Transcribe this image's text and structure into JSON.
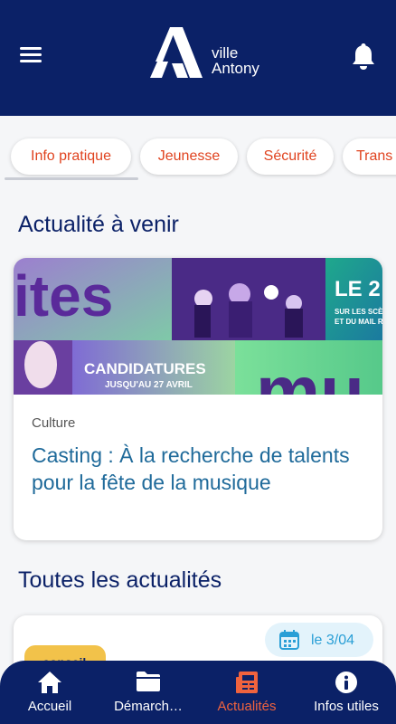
{
  "header": {
    "logo_line1": "ville",
    "logo_line2": "Antony",
    "menu_icon": "hamburger-menu-icon",
    "notification_icon": "bell-icon"
  },
  "chips": [
    "Info pratique",
    "Jeunesse",
    "Sécurité",
    "Trans"
  ],
  "upcoming": {
    "title": "Actualité à venir",
    "banner": {
      "word_left": "ites",
      "le_text": "LE 2",
      "le_sub1": "SUR LES SCÈ",
      "le_sub2": "ET DU MAIL R",
      "candidatures": "CANDIDATURES",
      "deadline": "JUSQU'AU 27 AVRIL",
      "word_right": "mu"
    },
    "category": "Culture",
    "headline": "Casting : À la recherche de talents pour la fête de la musique"
  },
  "all_news": {
    "title": "Toutes les actualités",
    "first": {
      "date": "le 3/04",
      "thumb_text": "conseil",
      "date_icon": "calendar-icon"
    }
  },
  "nav": [
    {
      "label": "Accueil",
      "icon": "home-icon"
    },
    {
      "label": "Démarch…",
      "icon": "folder-icon"
    },
    {
      "label": "Actualités",
      "icon": "newspaper-icon"
    },
    {
      "label": "Infos utiles",
      "icon": "info-icon"
    }
  ],
  "colors": {
    "primary": "#0b2167",
    "accent": "#f0633e",
    "chip_text": "#e0431f",
    "headline": "#1f6a9a",
    "badge": "#2a9fd6"
  }
}
